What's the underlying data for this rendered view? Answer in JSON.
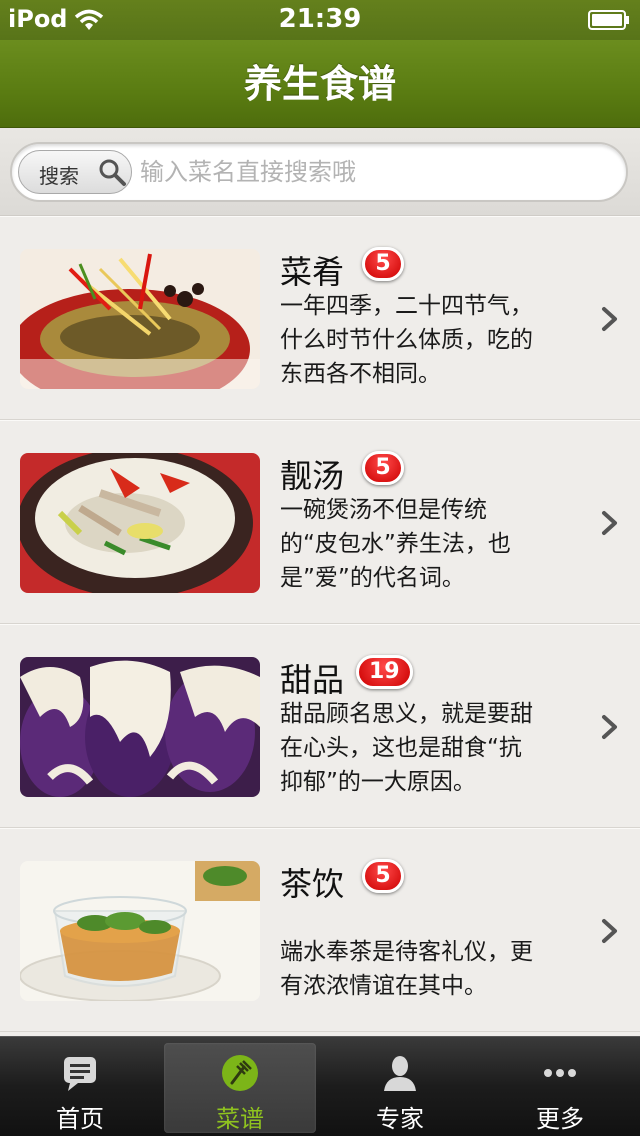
{
  "status_bar": {
    "carrier": "iPod",
    "time": "21:39"
  },
  "nav": {
    "title": "养生食谱"
  },
  "search": {
    "button_label": "搜索",
    "placeholder": "输入菜名直接搜索哦"
  },
  "items": [
    {
      "title": "菜肴",
      "badge": "5",
      "desc_lines": [
        "一年四季，二十四节气，",
        "什么时节什么体质，吃的",
        "东西各不相同。"
      ],
      "image": "fish-dish-photo"
    },
    {
      "title": "靓汤",
      "badge": "5",
      "desc_lines": [
        "一碗煲汤不但是传统",
        "的“皮包水”养生法，也",
        "是”爱”的代名词。"
      ],
      "image": "soup-pot-photo"
    },
    {
      "title": "甜品",
      "badge": "19",
      "desc_lines": [
        "甜品顾名思义，就是要甜",
        "在心头，这也是甜食“抗",
        "抑郁”的一大原因。"
      ],
      "image": "purple-dessert-photo"
    },
    {
      "title": "茶饮",
      "badge": "5",
      "desc_lines": [
        "",
        "端水奉茶是待客礼仪，更",
        "有浓浓情谊在其中。"
      ],
      "image": "tea-cup-photo"
    }
  ],
  "tabs": [
    {
      "label": "首页",
      "icon": "chat-icon"
    },
    {
      "label": "菜谱",
      "icon": "fork-icon"
    },
    {
      "label": "专家",
      "icon": "person-icon"
    },
    {
      "label": "更多",
      "icon": "more-icon"
    }
  ],
  "colors": {
    "accent": "#5a7c12",
    "badge": "#cc0000",
    "active_tab": "#8fc31f"
  }
}
